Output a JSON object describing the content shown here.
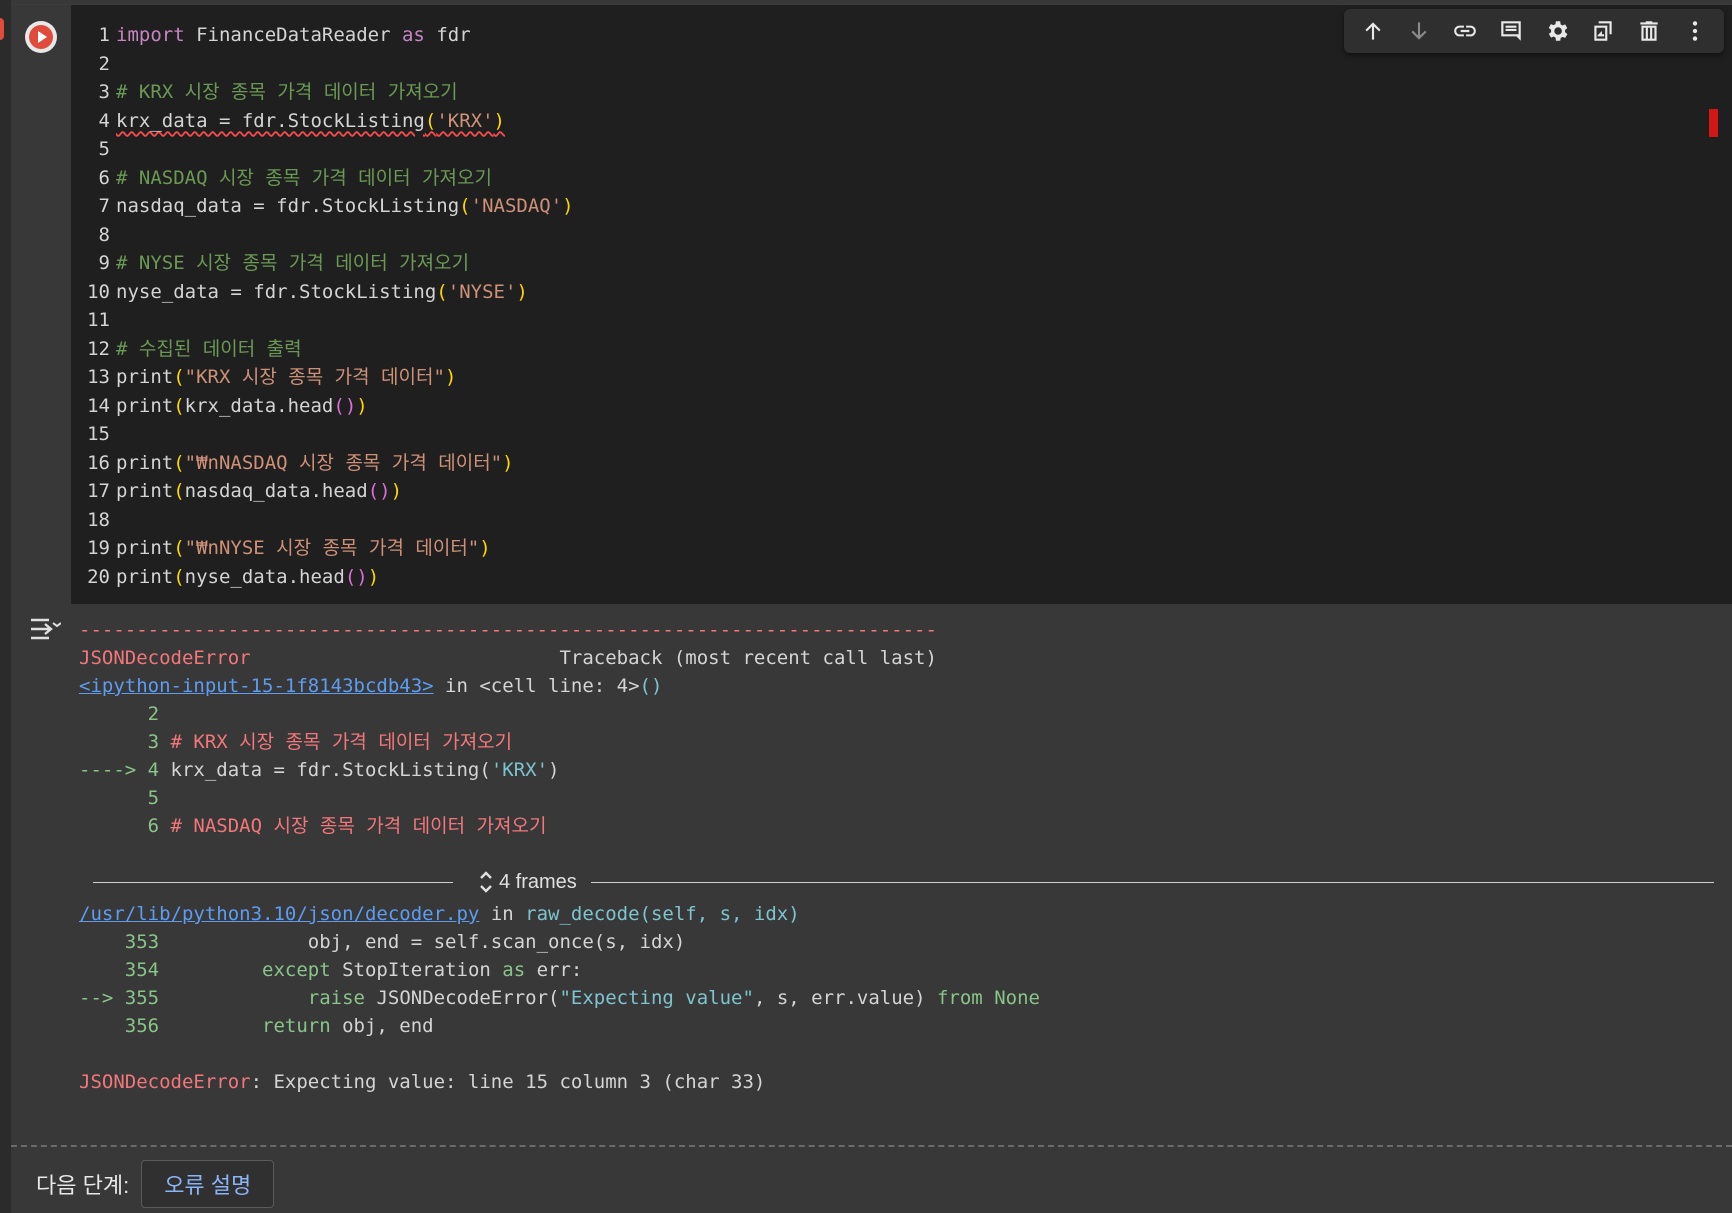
{
  "cell": {
    "lines": [
      {
        "n": "1",
        "segs": [
          {
            "c": "kw",
            "t": "import"
          },
          {
            "c": "fn",
            "t": " FinanceDataReader "
          },
          {
            "c": "kw",
            "t": "as"
          },
          {
            "c": "fn",
            "t": " fdr"
          }
        ]
      },
      {
        "n": "2",
        "segs": []
      },
      {
        "n": "3",
        "segs": [
          {
            "c": "cm",
            "t": "# KRX 시장 종목 가격 데이터 가져오기"
          }
        ]
      },
      {
        "n": "4",
        "segs": [
          {
            "c": "fn squig",
            "t": "krx_data = fdr.StockListing"
          },
          {
            "c": "pr squig",
            "t": "("
          },
          {
            "c": "st squig",
            "t": "'KRX'"
          },
          {
            "c": "pr squig",
            "t": ")"
          }
        ]
      },
      {
        "n": "5",
        "segs": []
      },
      {
        "n": "6",
        "segs": [
          {
            "c": "cm",
            "t": "# NASDAQ 시장 종목 가격 데이터 가져오기"
          }
        ]
      },
      {
        "n": "7",
        "segs": [
          {
            "c": "fn",
            "t": "nasdaq_data = fdr.StockListing"
          },
          {
            "c": "pr",
            "t": "("
          },
          {
            "c": "st",
            "t": "'NASDAQ'"
          },
          {
            "c": "pr",
            "t": ")"
          }
        ]
      },
      {
        "n": "8",
        "segs": []
      },
      {
        "n": "9",
        "segs": [
          {
            "c": "cm",
            "t": "# NYSE 시장 종목 가격 데이터 가져오기"
          }
        ]
      },
      {
        "n": "10",
        "segs": [
          {
            "c": "fn",
            "t": "nyse_data = fdr.StockListing"
          },
          {
            "c": "pr",
            "t": "("
          },
          {
            "c": "st",
            "t": "'NYSE'"
          },
          {
            "c": "pr",
            "t": ")"
          }
        ]
      },
      {
        "n": "11",
        "segs": []
      },
      {
        "n": "12",
        "segs": [
          {
            "c": "cm",
            "t": "# 수집된 데이터 출력"
          }
        ]
      },
      {
        "n": "13",
        "segs": [
          {
            "c": "fn",
            "t": "print"
          },
          {
            "c": "pr",
            "t": "("
          },
          {
            "c": "st",
            "t": "\"KRX 시장 종목 가격 데이터\""
          },
          {
            "c": "pr",
            "t": ")"
          }
        ]
      },
      {
        "n": "14",
        "segs": [
          {
            "c": "fn",
            "t": "print"
          },
          {
            "c": "pr",
            "t": "("
          },
          {
            "c": "fn",
            "t": "krx_data.head"
          },
          {
            "c": "pp",
            "t": "()"
          },
          {
            "c": "pr",
            "t": ")"
          }
        ]
      },
      {
        "n": "15",
        "segs": []
      },
      {
        "n": "16",
        "segs": [
          {
            "c": "fn",
            "t": "print"
          },
          {
            "c": "pr",
            "t": "("
          },
          {
            "c": "st",
            "t": "\"₩nNASDAQ 시장 종목 가격 데이터\""
          },
          {
            "c": "pr",
            "t": ")"
          }
        ]
      },
      {
        "n": "17",
        "segs": [
          {
            "c": "fn",
            "t": "print"
          },
          {
            "c": "pr",
            "t": "("
          },
          {
            "c": "fn",
            "t": "nasdaq_data.head"
          },
          {
            "c": "pp",
            "t": "()"
          },
          {
            "c": "pr",
            "t": ")"
          }
        ]
      },
      {
        "n": "18",
        "segs": []
      },
      {
        "n": "19",
        "segs": [
          {
            "c": "fn",
            "t": "print"
          },
          {
            "c": "pr",
            "t": "("
          },
          {
            "c": "st",
            "t": "\"₩nNYSE 시장 종목 가격 데이터\""
          },
          {
            "c": "pr",
            "t": ")"
          }
        ]
      },
      {
        "n": "20",
        "segs": [
          {
            "c": "fn",
            "t": "print"
          },
          {
            "c": "pr",
            "t": "("
          },
          {
            "c": "fn",
            "t": "nyse_data.head"
          },
          {
            "c": "pp",
            "t": "()"
          },
          {
            "c": "pr",
            "t": ")"
          }
        ]
      }
    ]
  },
  "toolbar": {
    "items": [
      "arrow-up-icon",
      "arrow-down-icon",
      "link-icon",
      "comment-icon",
      "gear-icon",
      "mirror-cell-icon",
      "trash-icon",
      "more-vert-icon"
    ]
  },
  "output": {
    "lines_top": [
      [
        {
          "c": "red",
          "t": "---------------------------------------------------------------------------"
        }
      ],
      [
        {
          "c": "red",
          "t": "JSONDecodeError"
        },
        {
          "c": "",
          "t": "                           Traceback (most recent call last)"
        }
      ],
      [
        {
          "c": "link",
          "t": "<ipython-input-15-1f8143bcdb43>"
        },
        {
          "c": "",
          "t": " in <cell line: 4>"
        },
        {
          "c": "cyan",
          "t": "()"
        }
      ],
      [
        {
          "c": "green",
          "t": "      2"
        }
      ],
      [
        {
          "c": "green",
          "t": "      3 "
        },
        {
          "c": "red",
          "t": "# KRX 시장 종목 가격 데이터 가져오기"
        }
      ],
      [
        {
          "c": "green",
          "t": "----> 4 "
        },
        {
          "c": "",
          "t": "krx_data = fdr.StockListing("
        },
        {
          "c": "cyan",
          "t": "'KRX'"
        },
        {
          "c": "",
          "t": ")"
        }
      ],
      [
        {
          "c": "green",
          "t": "      5"
        }
      ],
      [
        {
          "c": "green",
          "t": "      6 "
        },
        {
          "c": "red",
          "t": "# NASDAQ 시장 종목 가격 데이터 가져오기"
        }
      ]
    ],
    "frames_label": "4 frames",
    "lines_bottom": [
      [
        {
          "c": "link",
          "t": "/usr/lib/python3.10/json/decoder.py"
        },
        {
          "c": "",
          "t": " in "
        },
        {
          "c": "cyan",
          "t": "raw_decode(self, s, idx)"
        }
      ],
      [
        {
          "c": "green",
          "t": "    353 "
        },
        {
          "c": "",
          "t": "            obj, end = self.scan_once(s, idx)"
        }
      ],
      [
        {
          "c": "green",
          "t": "    354 "
        },
        {
          "c": "",
          "t": "        "
        },
        {
          "c": "green",
          "t": "except"
        },
        {
          "c": "",
          "t": " StopIteration "
        },
        {
          "c": "green",
          "t": "as"
        },
        {
          "c": "",
          "t": " err:"
        }
      ],
      [
        {
          "c": "green",
          "t": "--> 355 "
        },
        {
          "c": "",
          "t": "            "
        },
        {
          "c": "green",
          "t": "raise"
        },
        {
          "c": "",
          "t": " JSONDecodeError("
        },
        {
          "c": "cyan",
          "t": "\"Expecting value\""
        },
        {
          "c": "",
          "t": ", s, err.value) "
        },
        {
          "c": "green",
          "t": "from"
        },
        {
          "c": "",
          "t": " "
        },
        {
          "c": "green",
          "t": "None"
        }
      ],
      [
        {
          "c": "green",
          "t": "    356 "
        },
        {
          "c": "",
          "t": "        "
        },
        {
          "c": "green",
          "t": "return"
        },
        {
          "c": "",
          "t": " obj, end"
        }
      ],
      [],
      [
        {
          "c": "red",
          "t": "JSONDecodeError"
        },
        {
          "c": "",
          "t": ": Expecting value: line 15 column 3 (char 33)"
        }
      ]
    ]
  },
  "next_steps": {
    "label": "다음 단계:",
    "button": "오류 설명"
  }
}
